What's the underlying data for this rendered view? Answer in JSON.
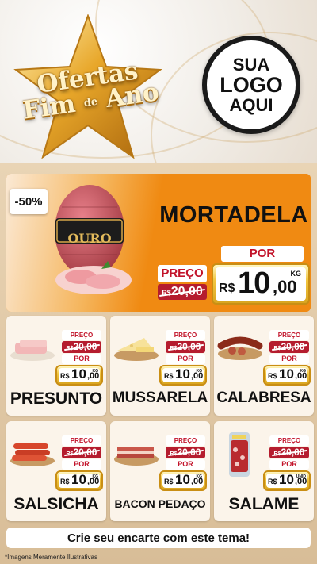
{
  "header": {
    "brand_line1": "Ofertas",
    "brand_line2a": "Fim",
    "brand_de": "de",
    "brand_line2b": "Ano",
    "logo_line1": "SUA",
    "logo_line2": "LOGO",
    "logo_line3": "AQUI"
  },
  "hero": {
    "discount": "-50%",
    "product": "MORTADELA",
    "package_brand": "OURO",
    "price_label": "PREÇO",
    "old_price_currency": "R$",
    "old_price": "20,00",
    "por_label": "POR",
    "new_price_currency": "R$",
    "new_price_int": "10",
    "new_price_dec": ",00",
    "unit": "KG"
  },
  "products": [
    {
      "name": "PRESUNTO",
      "price_label": "PREÇO",
      "old_currency": "R$",
      "old_price": "20,00",
      "por_label": "POR",
      "currency": "R$",
      "price_int": "10",
      "price_dec": ",00",
      "unit": "KG"
    },
    {
      "name": "MUSSARELA",
      "price_label": "PREÇO",
      "old_currency": "R$",
      "old_price": "20,00",
      "por_label": "POR",
      "currency": "R$",
      "price_int": "10",
      "price_dec": ",00",
      "unit": "KG"
    },
    {
      "name": "CALABRESA",
      "price_label": "PREÇO",
      "old_currency": "R$",
      "old_price": "20,00",
      "por_label": "POR",
      "currency": "R$",
      "price_int": "10",
      "price_dec": ",00",
      "unit": "KG"
    },
    {
      "name": "SALSICHA",
      "price_label": "PREÇO",
      "old_currency": "R$",
      "old_price": "20,00",
      "por_label": "POR",
      "currency": "R$",
      "price_int": "10",
      "price_dec": ",00",
      "unit": "KG"
    },
    {
      "name": "BACON PEDAÇO",
      "price_label": "PREÇO",
      "old_currency": "R$",
      "old_price": "20,00",
      "por_label": "POR",
      "currency": "R$",
      "price_int": "10",
      "price_dec": ",00",
      "unit": "KG"
    },
    {
      "name": "SALAME",
      "price_label": "PREÇO",
      "old_currency": "R$",
      "old_price": "20,00",
      "por_label": "POR",
      "currency": "R$",
      "price_int": "10",
      "price_dec": ",00",
      "unit": "UNID"
    }
  ],
  "footer": {
    "cta": "Crie seu encarte com este tema!",
    "disclaimer": "*Imagens Meramente Ilustrativas"
  },
  "colors": {
    "orange": "#ef8a12",
    "red": "#b51c2e",
    "gold": "#f2c640",
    "background": "#e9d4b5"
  }
}
